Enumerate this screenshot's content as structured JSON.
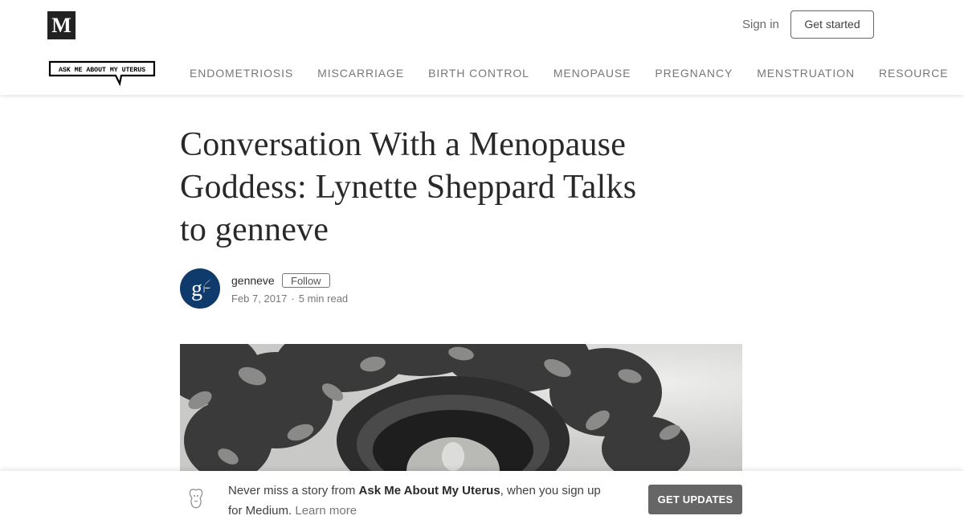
{
  "header": {
    "logo_letter": "M",
    "sign_in": "Sign in",
    "get_started": "Get started",
    "publication_logo_text": "ASK ME ABOUT MY UTERUS",
    "nav": [
      "ENDOMETRIOSIS",
      "MISCARRIAGE",
      "BIRTH CONTROL",
      "MENOPAUSE",
      "PREGNANCY",
      "MENSTRUATION",
      "RESOURCE"
    ]
  },
  "article": {
    "title_lines": [
      "Conversation With a Menopause",
      "Goddess: Lynette Sheppard Talks",
      "to genneve"
    ],
    "author": "genneve",
    "avatar_letter": "g",
    "follow": "Follow",
    "date": "Feb 7, 2017",
    "separator": "·",
    "read_time": "5 min read"
  },
  "banner": {
    "text_before": "Never miss a story from ",
    "publication": "Ask Me About My Uterus",
    "text_after": ", when you sign up for Medium.",
    "learn_more": "Learn more",
    "button": "GET UPDATES"
  },
  "colors": {
    "avatar_bg": "#0f3a6c",
    "button_bg": "#666666",
    "logo_bg": "#222222"
  },
  "icons": {
    "banner_icon": "publication-mascot-icon"
  }
}
